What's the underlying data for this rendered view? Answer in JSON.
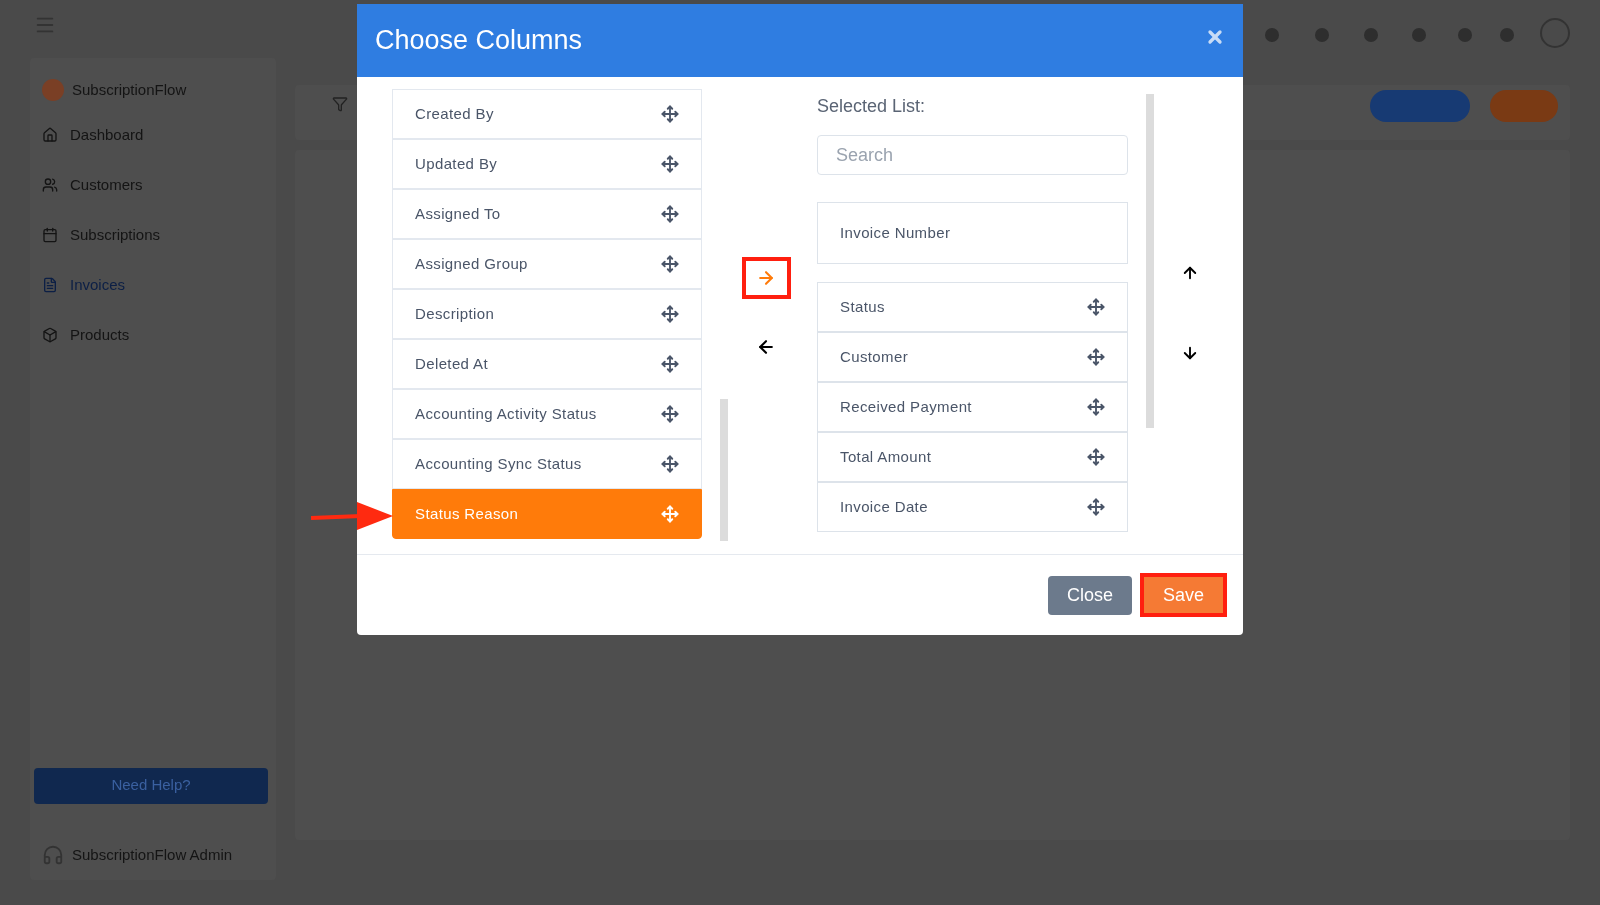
{
  "sidebar": {
    "brand": "SubscriptionFlow",
    "items": [
      {
        "label": "Dashboard",
        "selected": false
      },
      {
        "label": "Customers",
        "selected": false
      },
      {
        "label": "Subscriptions",
        "selected": false
      },
      {
        "label": "Invoices",
        "selected": true
      },
      {
        "label": "Products",
        "selected": false
      }
    ],
    "help_button": "Need Help?",
    "user": "SubscriptionFlow Admin"
  },
  "dialog": {
    "title": "Choose Columns",
    "available": [
      {
        "label": "Created By",
        "selected": false
      },
      {
        "label": "Updated By",
        "selected": false
      },
      {
        "label": "Assigned To",
        "selected": false
      },
      {
        "label": "Assigned Group",
        "selected": false
      },
      {
        "label": "Description",
        "selected": false
      },
      {
        "label": "Deleted At",
        "selected": false
      },
      {
        "label": "Accounting Activity Status",
        "selected": false
      },
      {
        "label": "Accounting Sync Status",
        "selected": false
      },
      {
        "label": "Status Reason",
        "selected": true
      }
    ],
    "selected_label": "Selected List:",
    "search": {
      "placeholder": "Search"
    },
    "selected_items": [
      {
        "label": "Invoice Number",
        "kind": "fixed"
      },
      {
        "label": "Status",
        "kind": "movable"
      },
      {
        "label": "Customer",
        "kind": "movable"
      },
      {
        "label": "Received Payment",
        "kind": "movable"
      },
      {
        "label": "Total Amount",
        "kind": "movable"
      },
      {
        "label": "Invoice Date",
        "kind": "movable"
      }
    ],
    "buttons": [
      {
        "label": "Close",
        "kind": "secondary"
      },
      {
        "label": "Save",
        "kind": "primary"
      }
    ]
  }
}
